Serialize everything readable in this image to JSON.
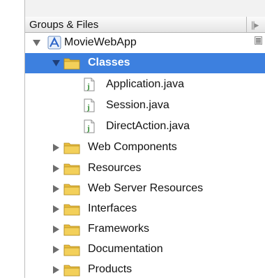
{
  "header": {
    "label": "Groups & Files",
    "resize_glyph": "||▸"
  },
  "tree": [
    {
      "label": "MovieWebApp",
      "icon": "project-icon",
      "expanded": true,
      "level": 0
    },
    {
      "label": "Classes",
      "icon": "folder-icon",
      "expanded": true,
      "level": 1,
      "selected": true
    },
    {
      "label": "Application.java",
      "icon": "java-file-icon",
      "level": 2
    },
    {
      "label": "Session.java",
      "icon": "java-file-icon",
      "level": 2
    },
    {
      "label": "DirectAction.java",
      "icon": "java-file-icon",
      "level": 2
    },
    {
      "label": "Web Components",
      "icon": "folder-icon",
      "expanded": false,
      "level": 1
    },
    {
      "label": "Resources",
      "icon": "folder-icon",
      "expanded": false,
      "level": 1
    },
    {
      "label": "Web Server Resources",
      "icon": "folder-icon",
      "expanded": false,
      "level": 1
    },
    {
      "label": "Interfaces",
      "icon": "folder-icon",
      "expanded": false,
      "level": 1
    },
    {
      "label": "Frameworks",
      "icon": "folder-icon",
      "expanded": false,
      "level": 1
    },
    {
      "label": "Documentation",
      "icon": "folder-icon",
      "expanded": false,
      "level": 1
    },
    {
      "label": "Products",
      "icon": "folder-icon",
      "expanded": false,
      "level": 1
    }
  ],
  "colors": {
    "selection": "#3d80df",
    "folder": "#f3d05a",
    "header_bg": "#ececec"
  }
}
